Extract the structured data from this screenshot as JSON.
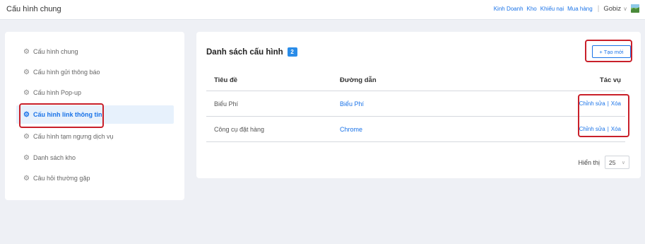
{
  "header": {
    "title": "Cấu hình chung",
    "nav_links": [
      "Kinh Doanh",
      "Kho",
      "Khiếu nại",
      "Mua hàng"
    ],
    "user_name": "Gobiz"
  },
  "sidebar": {
    "items": [
      {
        "label": "Cấu hình chung",
        "icon": "gears-icon"
      },
      {
        "label": "Cấu hình gửi thông báo",
        "icon": "gears-icon"
      },
      {
        "label": "Cấu hình Pop-up",
        "icon": "gears-icon"
      },
      {
        "label": "Cấu hình link thông tin",
        "icon": "gears-icon",
        "active": true
      },
      {
        "label": "Cấu hình tạm ngưng dịch vụ",
        "icon": "gears-icon"
      },
      {
        "label": "Danh sách kho",
        "icon": "gears-icon"
      },
      {
        "label": "Câu hỏi thường gặp",
        "icon": "gears-icon"
      }
    ]
  },
  "main": {
    "title": "Danh sách cấu hình",
    "count": "2",
    "create_label": "+ Tạo mới",
    "columns": [
      "Tiêu đề",
      "Đường dẫn",
      "Tác vụ"
    ],
    "rows": [
      {
        "title": "Biểu Phí",
        "link": "Biểu Phí",
        "edit": "Chỉnh sửa",
        "sep": "|",
        "delete": "Xóa"
      },
      {
        "title": "Công cụ đặt hàng",
        "link": "Chrome",
        "edit": "Chỉnh sửa",
        "sep": "|",
        "delete": "Xóa"
      }
    ],
    "page_size_label": "Hiển thị",
    "page_size_value": "25"
  },
  "colors": {
    "accent": "#1a73e8",
    "badge": "#2a8ce8",
    "highlight": "#c9202a",
    "background": "#eef0f5"
  }
}
